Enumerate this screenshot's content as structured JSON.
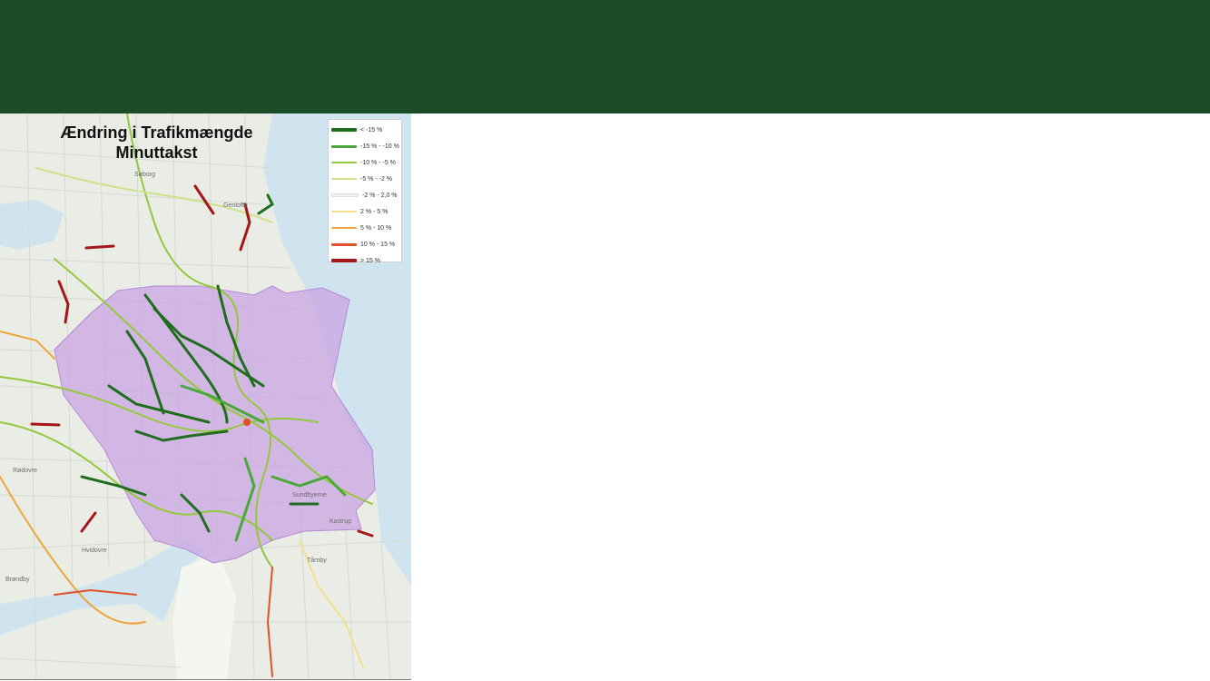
{
  "map": {
    "title_line1": "Ændring i Trafikmængde",
    "title_line2": "Minuttakst",
    "legend": [
      {
        "label": "< -15 %",
        "color": "#1e6e1e",
        "weight": 4
      },
      {
        "label": "-15 % - -10 %",
        "color": "#4aa83a",
        "weight": 3
      },
      {
        "label": "-10 % - -5 %",
        "color": "#94c83c",
        "weight": 2
      },
      {
        "label": "-5 % - -2 %",
        "color": "#cfe28a",
        "weight": 2
      },
      {
        "label": "-2 % - 2,0 %",
        "color": "#f1f1ea",
        "weight": 2
      },
      {
        "label": "2 % - 5 %",
        "color": "#f2e08c",
        "weight": 2
      },
      {
        "label": "5 % - 10 %",
        "color": "#f0a43a",
        "weight": 2
      },
      {
        "label": "10 % - 15 %",
        "color": "#e2502a",
        "weight": 3
      },
      {
        "label": "> 15 %",
        "color": "#a51616",
        "weight": 4
      }
    ],
    "place_labels": [
      "Gentofte",
      "Søborg",
      "Rødovre",
      "Hvidovre",
      "Brøndby",
      "Tårnby",
      "Kastrup",
      "Sundbyerne"
    ],
    "colors": {
      "zone": "#c9a4e3",
      "water": "#cfe4ef",
      "land": "#e9ede6",
      "header": "#1c4c28"
    }
  }
}
